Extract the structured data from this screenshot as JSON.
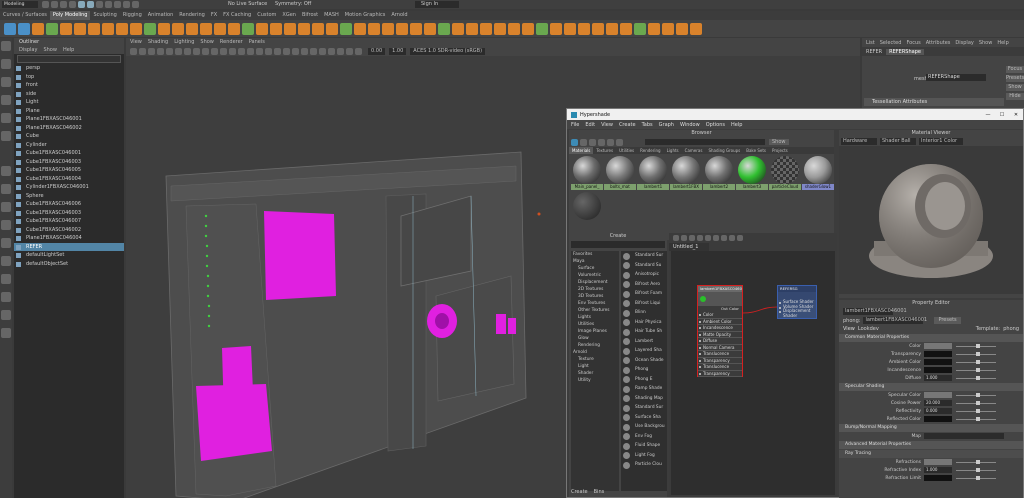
{
  "top_bar": {
    "workspace": "Modeling",
    "live_surface": "No Live Surface",
    "symmetry": "Symmetry: Off",
    "sign_in": "Sign In"
  },
  "shelf_tabs": [
    "Curves / Surfaces",
    "Poly Modeling",
    "Sculpting",
    "Rigging",
    "Animation",
    "Rendering",
    "FX",
    "FX Caching",
    "Custom",
    "XGen",
    "Bifrost",
    "MASH",
    "Motion Graphics",
    "Arnold"
  ],
  "shelf_active": "Poly Modeling",
  "outliner": {
    "title": "Outliner",
    "menu": [
      "Display",
      "Show",
      "Help"
    ],
    "items": [
      "persp",
      "top",
      "front",
      "side",
      "Light",
      "Plane",
      "Plane1FBXASC046001",
      "Plane1FBXASC046002",
      "Cube",
      "Cylinder",
      "Cube1FBXASC046001",
      "Cube1FBXASC046003",
      "Cube1FBXASC046005",
      "Cube1FBXASC046004",
      "Cylinder1FBXASC046001",
      "Sphere",
      "Cube1FBXASC046006",
      "Cube1FBXASC046003",
      "Cube1FBXASC046007",
      "Cube1FBXASC046002",
      "Plane1FBXASC046004",
      "REFER",
      "defaultLightSet",
      "defaultObjectSet"
    ],
    "selected": "REFER"
  },
  "viewport": {
    "menu": [
      "View",
      "Shading",
      "Lighting",
      "Show",
      "Renderer",
      "Panels"
    ],
    "field_a": "0.00",
    "field_b": "1.00",
    "colorspace": "ACES 1.0 SDR-video (sRGB)"
  },
  "attr_editor": {
    "menu": [
      "List",
      "Selected",
      "Focus",
      "Attributes",
      "Display",
      "Show",
      "Help"
    ],
    "tab_a": "REFER",
    "tab_b": "REFERShape",
    "node_label": "mesh:",
    "node_value": "REFERShape",
    "btn_focus": "Focus",
    "btn_presets": "Presets",
    "btn_show": "Show",
    "btn_hide": "Hide",
    "section": "Tessellation Attributes"
  },
  "hypershade": {
    "title": "Hypershade",
    "menu": [
      "File",
      "Edit",
      "View",
      "Create",
      "Tabs",
      "Graph",
      "Window",
      "Options",
      "Help"
    ],
    "browser_title": "Browser",
    "browser_tabs": [
      "Materials",
      "Textures",
      "Utilities",
      "Rendering",
      "Lights",
      "Cameras",
      "Shading Groups",
      "Bake Sets",
      "Projects"
    ],
    "show_btn": "Show",
    "swatches": [
      {
        "label": "Main_panel_",
        "color": "#6b6b6b"
      },
      {
        "label": "bolts_mat",
        "color": "#7a7a7a"
      },
      {
        "label": "lambert1",
        "color": "#6f6f6f"
      },
      {
        "label": "lambert1FBX",
        "color": "#777777"
      },
      {
        "label": "lambert2",
        "color": "#707070"
      },
      {
        "label": "lambert3",
        "color": "#30c030"
      },
      {
        "label": "particleCloud",
        "color": "#3a8a9a"
      },
      {
        "label": "shaderGlow1",
        "color": "#9a9a9a"
      },
      {
        "label": "",
        "color": "#555555"
      }
    ],
    "create_title": "Create",
    "create_tree": [
      "Favorites",
      "Maya",
      "Surface",
      "Volumetric",
      "Displacement",
      "2D Textures",
      "3D Textures",
      "Env Textures",
      "Other Textures",
      "Lights",
      "Utilities",
      "Image Planes",
      "Glow",
      "Rendering",
      "Arnold",
      "Texture",
      "Light",
      "Shader",
      "Utility"
    ],
    "create_list": [
      "Standard Sur",
      "Standard Su",
      "Anisotropic",
      "Bifrost Aero",
      "Bifrost Foam",
      "Bifrost Liqui",
      "Blinn",
      "Hair Physica",
      "Hair Tube Sh",
      "Lambert",
      "Layered Sha",
      "Ocean Shade",
      "Phong",
      "Phong E",
      "Ramp Shade",
      "Shading Map",
      "Standard Sur",
      "Surface Sha",
      "Use Backgrou",
      "Env Fog",
      "Fluid Shape",
      "Light Fog",
      "Particle Clou"
    ],
    "create_tabs": [
      "Create",
      "Bins"
    ],
    "graph_tab": "Untitled_1",
    "node1": {
      "title": "lambert1FBXASC046001",
      "out": "Out Color",
      "attrs": [
        "Color",
        "Ambient Color",
        "Incandescence",
        "Matte Opacity",
        "Diffuse",
        "Normal Camera",
        "Translucence",
        "Transparency",
        "Translucence",
        "Transparency"
      ]
    },
    "node2": {
      "title": "REFERSG",
      "attrs": [
        "Surface Shader",
        "Volume Shader",
        "Displacement Shader"
      ]
    },
    "viewer_title": "Material Viewer",
    "viewer_renderer": "Hardware",
    "viewer_shape": "Shader Ball",
    "viewer_env": "Interior1 Color",
    "pe_title": "Property Editor",
    "pe_node": "lambert1FBXASC046001",
    "pe_type": "phong:",
    "pe_presets": "Presets",
    "pe_view": "View",
    "pe_lookdev": "Lookdev",
    "pe_template": "Template:",
    "pe_template_val": "phong",
    "sections": {
      "common": "Common Material Properties",
      "specular": "Specular Shading",
      "bump": "Bump/Normal Mapping",
      "advanced": "Advanced Material Properties",
      "raytrace": "Ray Tracing"
    },
    "props_common": [
      "Color",
      "Transparency",
      "Ambient Color",
      "Incandescence",
      "Diffuse"
    ],
    "diffuse_value": "1.000",
    "props_spec": [
      "Specular Color",
      "Cosine Power",
      "Reflectivity",
      "Reflected Color"
    ],
    "cosine_value": "20.000",
    "reflectivity_value": "0.000",
    "bump_label": "Map",
    "props_ray": [
      "Refractions",
      "Refractive Index",
      "Refraction Limit"
    ],
    "refr_index": "1.000"
  },
  "colors": {
    "accent": "#d9822b",
    "selection": "#5285a6",
    "magenta": "#e020e0",
    "node_red": "#d62020"
  }
}
